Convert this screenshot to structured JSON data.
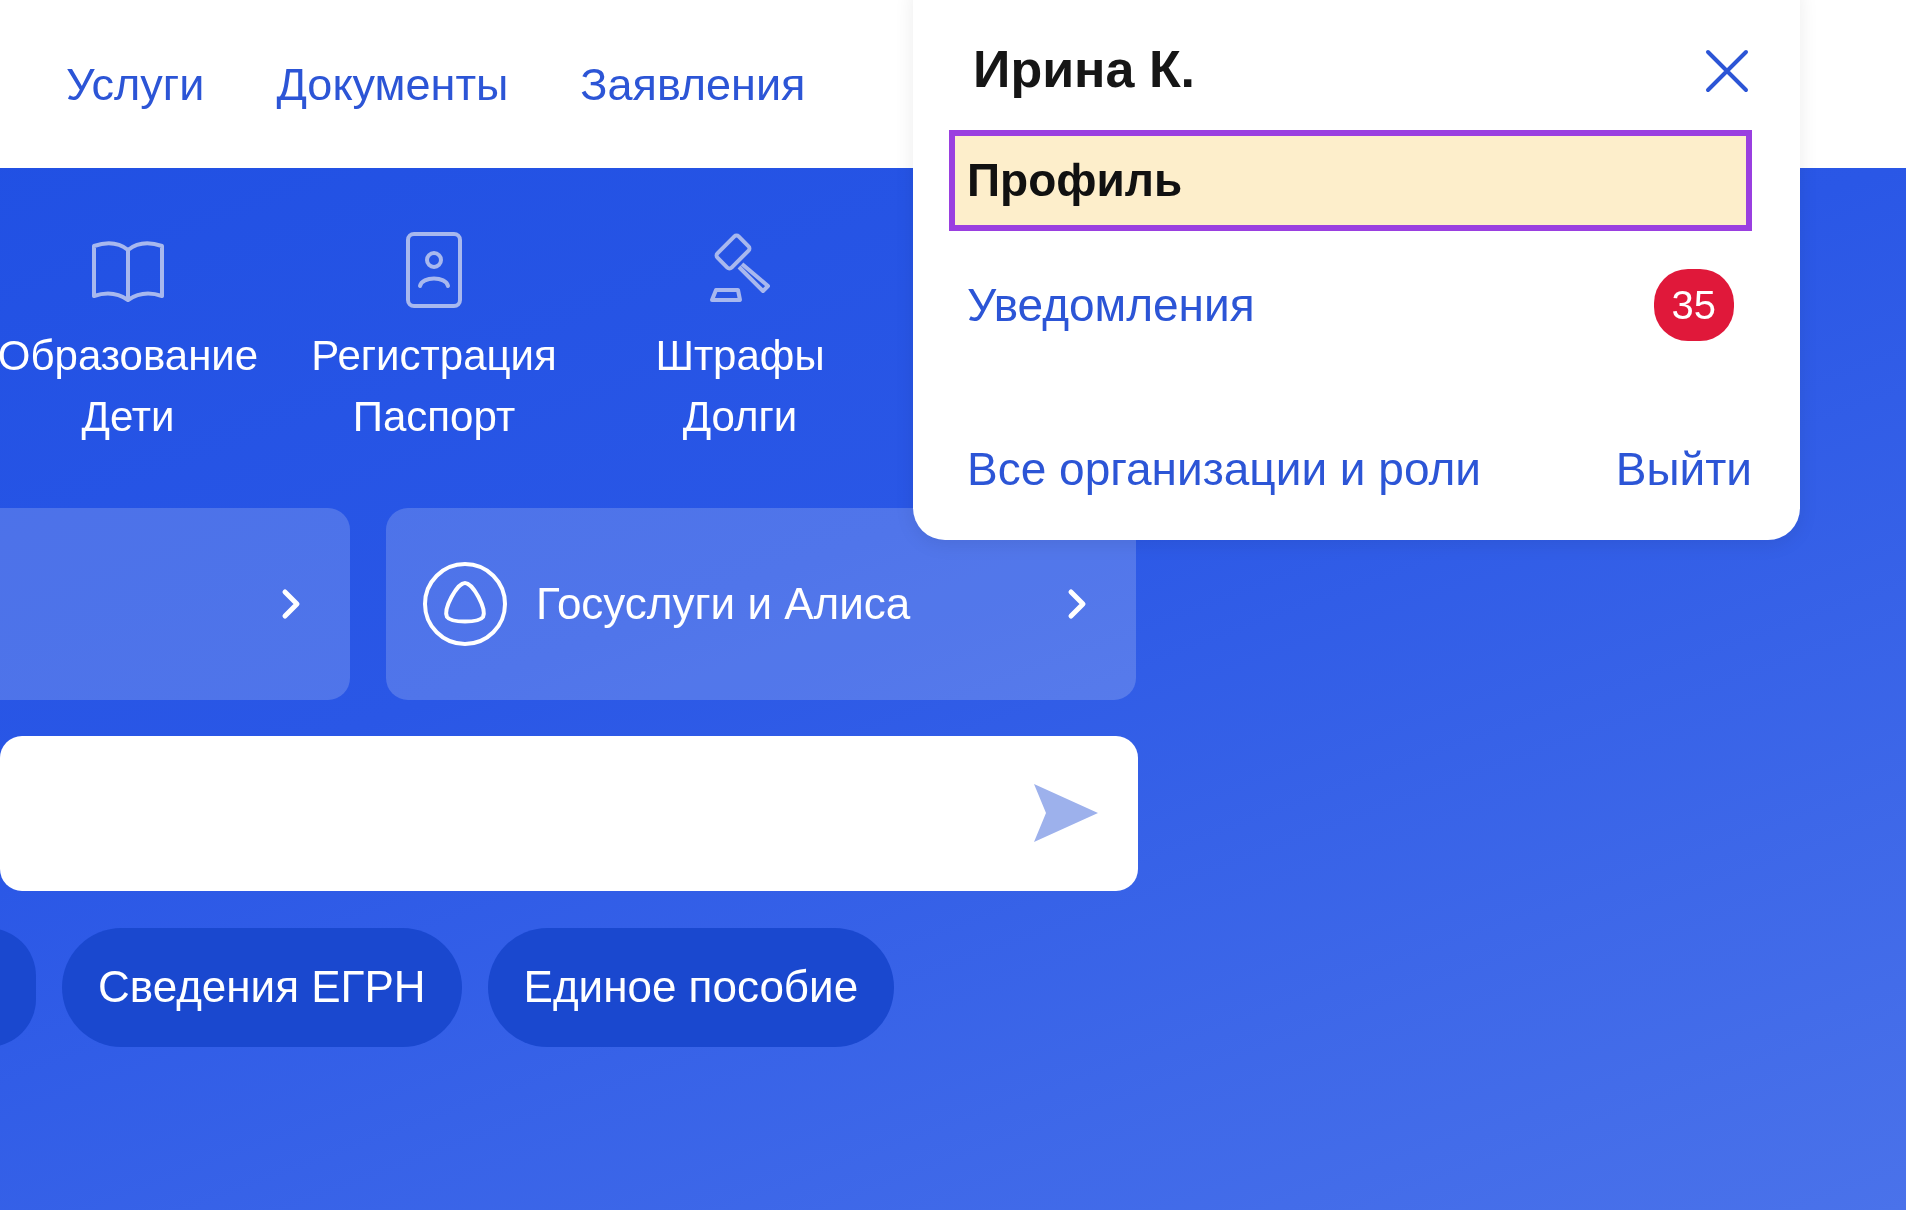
{
  "nav": {
    "links": [
      {
        "label": "Услуги"
      },
      {
        "label": "Документы"
      },
      {
        "label": "Заявления"
      }
    ]
  },
  "categories": [
    {
      "kind": "book",
      "lines": [
        "Образование",
        "Дети"
      ]
    },
    {
      "kind": "passport",
      "lines": [
        "Регистрация",
        "Паспорт"
      ]
    },
    {
      "kind": "gavel",
      "lines": [
        "Штрафы",
        "Долги"
      ]
    }
  ],
  "cards": [
    {
      "kind": "blank"
    },
    {
      "kind": "assistant",
      "label": "Госуслуги и Алиса"
    }
  ],
  "chips": [
    {
      "kind": "partial"
    },
    {
      "kind": "full",
      "label": "Сведения ЕГРН"
    },
    {
      "kind": "full",
      "label": "Единое пособие"
    }
  ],
  "popup": {
    "user_name": "Ирина К.",
    "items": [
      {
        "label": "Профиль",
        "selected": true
      },
      {
        "label": "Уведомления",
        "selected": false,
        "badge": "35"
      }
    ],
    "footer_links": [
      "Все организации и роли",
      "Выйти"
    ]
  }
}
